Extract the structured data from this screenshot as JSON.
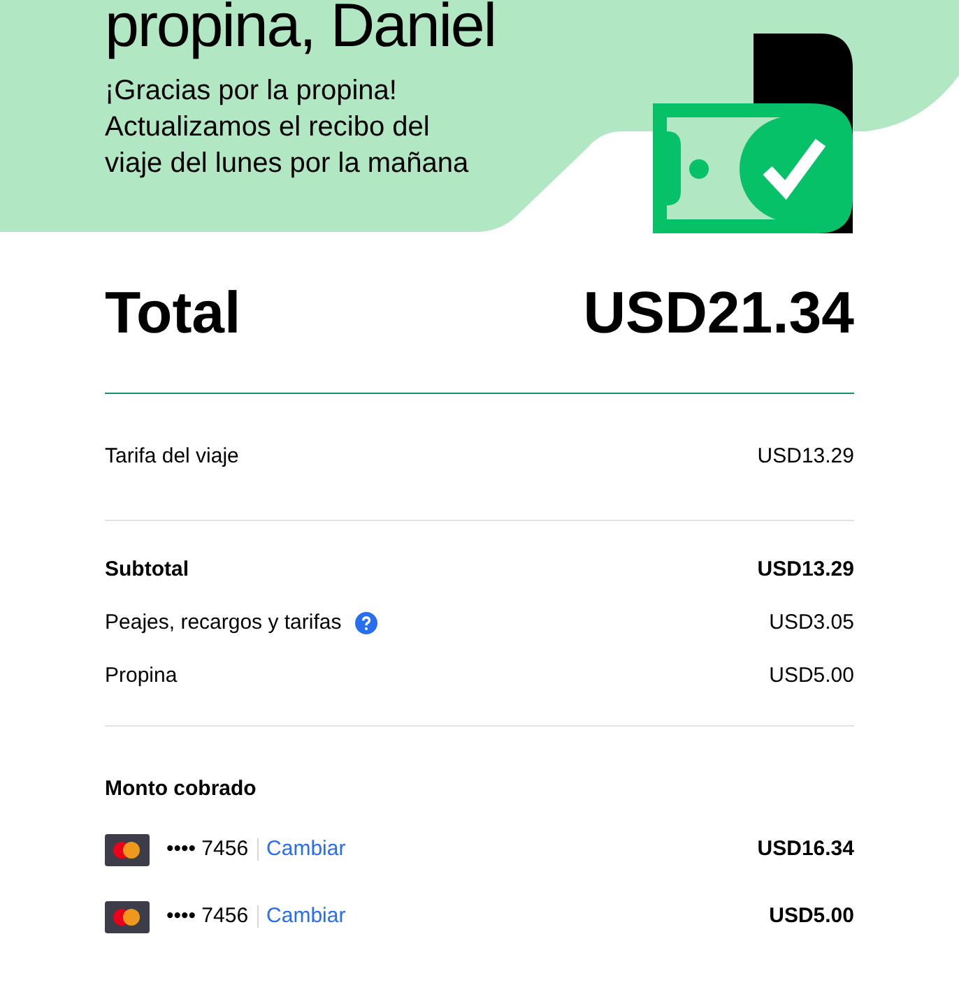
{
  "header": {
    "title": "propina, Daniel",
    "message_lines": [
      "¡Gracias por la propina!",
      "Actualizamos el recibo del",
      "viaje del lunes por la mañana"
    ]
  },
  "total": {
    "label": "Total",
    "amount": "USD21.34"
  },
  "fare": {
    "label": "Tarifa del viaje",
    "amount": "USD13.29"
  },
  "breakdown": [
    {
      "label": "Subtotal",
      "amount": "USD13.29",
      "kind": "bold",
      "help": false
    },
    {
      "label": "Peajes, recargos y tarifas",
      "amount": "USD3.05",
      "kind": "plain",
      "help": true
    },
    {
      "label": "Propina",
      "amount": "USD5.00",
      "kind": "plain",
      "help": false
    }
  ],
  "charged": {
    "title": "Monto cobrado",
    "payments": [
      {
        "masked": "••••",
        "last4": "7456",
        "action": "Cambiar",
        "amount": "USD16.34"
      },
      {
        "masked": "••••",
        "last4": "7456",
        "action": "Cambiar",
        "amount": "USD5.00"
      }
    ]
  }
}
